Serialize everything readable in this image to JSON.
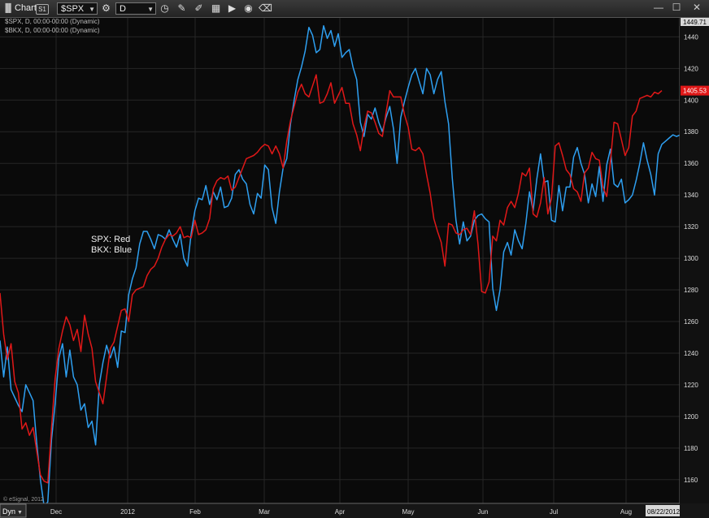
{
  "window": {
    "app_icon": "chart-bars-icon",
    "title": "Chart",
    "link_badge": "S1",
    "symbol": "$SPX",
    "interval": "D",
    "icons": [
      "gear-icon",
      "clock-icon",
      "pencil-icon",
      "draw-icon",
      "gallery-icon",
      "play-icon",
      "record-icon",
      "eraser-icon"
    ],
    "controls": [
      "minimize-icon",
      "maximize-icon",
      "close-icon"
    ]
  },
  "study_labels": [
    "$SPX, D, 00:00-00:00 (Dynamic)",
    "$BKX, D, 00:00-00:00 (Dynamic)"
  ],
  "legend_text": [
    "SPX:  Red",
    "BKX:  Blue"
  ],
  "watermark": "© eSignal, 2012",
  "bottom": {
    "dyn_label": "Dyn",
    "date_box": "08/22/2012"
  },
  "chart_data": {
    "type": "line",
    "x_labels": [
      "Dec",
      "2012",
      "Feb",
      "Mar",
      "Apr",
      "May",
      "Jun",
      "Jul",
      "Aug"
    ],
    "ylim": [
      1145,
      1452
    ],
    "y_ticks": [
      1160,
      1180,
      1200,
      1220,
      1240,
      1260,
      1280,
      1300,
      1320,
      1340,
      1360,
      1380,
      1400,
      1420,
      1440
    ],
    "grid": true,
    "series": [
      {
        "name": "SPX",
        "color": "#e01818",
        "last_label": "1405.53",
        "values": [
          1278,
          1252,
          1236,
          1246,
          1222,
          1215,
          1192,
          1196,
          1188,
          1193,
          1178,
          1163,
          1159,
          1158,
          1192,
          1224,
          1243,
          1254,
          1263,
          1258,
          1248,
          1255,
          1241,
          1264,
          1252,
          1243,
          1222,
          1215,
          1208,
          1225,
          1243,
          1247,
          1257,
          1267,
          1268,
          1260,
          1277,
          1280,
          1281,
          1282,
          1289,
          1293,
          1295,
          1300,
          1307,
          1312,
          1315,
          1314,
          1316,
          1320,
          1313,
          1314,
          1313,
          1324,
          1315,
          1316,
          1318,
          1325,
          1344,
          1349,
          1351,
          1350,
          1352,
          1343,
          1345,
          1351,
          1357,
          1363,
          1364,
          1365,
          1367,
          1370,
          1372,
          1371,
          1366,
          1371,
          1366,
          1357,
          1374,
          1387,
          1396,
          1405,
          1410,
          1404,
          1402,
          1409,
          1416,
          1398,
          1399,
          1404,
          1411,
          1398,
          1403,
          1408,
          1398,
          1398,
          1385,
          1378,
          1368,
          1383,
          1393,
          1392,
          1386,
          1379,
          1377,
          1392,
          1406,
          1402,
          1402,
          1402,
          1391,
          1383,
          1369,
          1368,
          1370,
          1366,
          1353,
          1341,
          1325,
          1317,
          1310,
          1295,
          1322,
          1321,
          1316,
          1315,
          1318,
          1319,
          1315,
          1330,
          1309,
          1279,
          1278,
          1285,
          1314,
          1311,
          1324,
          1321,
          1332,
          1336,
          1332,
          1341,
          1354,
          1352,
          1357,
          1328,
          1326,
          1335,
          1351,
          1328,
          1338,
          1371,
          1373,
          1365,
          1356,
          1353,
          1344,
          1342,
          1336,
          1354,
          1357,
          1367,
          1363,
          1362,
          1345,
          1339,
          1361,
          1386,
          1385,
          1375,
          1365,
          1370,
          1390,
          1393,
          1401,
          1402,
          1403,
          1402,
          1405,
          1404,
          1406
        ]
      },
      {
        "name": "BKX",
        "color": "#2e9ff0",
        "values": [
          1248,
          1225,
          1244,
          1217,
          1212,
          1207,
          1203,
          1220,
          1215,
          1210,
          1183,
          1160,
          1143,
          1146,
          1185,
          1208,
          1237,
          1246,
          1225,
          1242,
          1225,
          1220,
          1204,
          1208,
          1193,
          1197,
          1182,
          1220,
          1234,
          1245,
          1237,
          1244,
          1231,
          1254,
          1253,
          1277,
          1287,
          1294,
          1309,
          1317,
          1317,
          1312,
          1306,
          1315,
          1314,
          1312,
          1318,
          1312,
          1307,
          1315,
          1300,
          1295,
          1316,
          1330,
          1338,
          1337,
          1346,
          1334,
          1342,
          1337,
          1345,
          1332,
          1333,
          1338,
          1353,
          1356,
          1350,
          1347,
          1334,
          1328,
          1341,
          1338,
          1359,
          1356,
          1332,
          1322,
          1342,
          1357,
          1363,
          1385,
          1400,
          1413,
          1421,
          1431,
          1446,
          1441,
          1430,
          1432,
          1447,
          1439,
          1444,
          1434,
          1442,
          1427,
          1430,
          1432,
          1421,
          1413,
          1386,
          1377,
          1391,
          1388,
          1395,
          1386,
          1380,
          1389,
          1396,
          1382,
          1360,
          1389,
          1399,
          1408,
          1416,
          1420,
          1412,
          1404,
          1420,
          1416,
          1404,
          1413,
          1418,
          1399,
          1385,
          1351,
          1324,
          1309,
          1323,
          1311,
          1314,
          1324,
          1327,
          1328,
          1325,
          1323,
          1281,
          1267,
          1280,
          1304,
          1310,
          1302,
          1318,
          1311,
          1306,
          1322,
          1342,
          1330,
          1350,
          1366,
          1348,
          1349,
          1324,
          1323,
          1346,
          1330,
          1345,
          1345,
          1364,
          1370,
          1360,
          1353,
          1335,
          1347,
          1339,
          1358,
          1336,
          1359,
          1369,
          1347,
          1345,
          1350,
          1335,
          1337,
          1340,
          1349,
          1360,
          1373,
          1362,
          1353,
          1340,
          1366,
          1372,
          1374,
          1376,
          1378,
          1377,
          1378,
          1380,
          1380
        ]
      }
    ]
  }
}
